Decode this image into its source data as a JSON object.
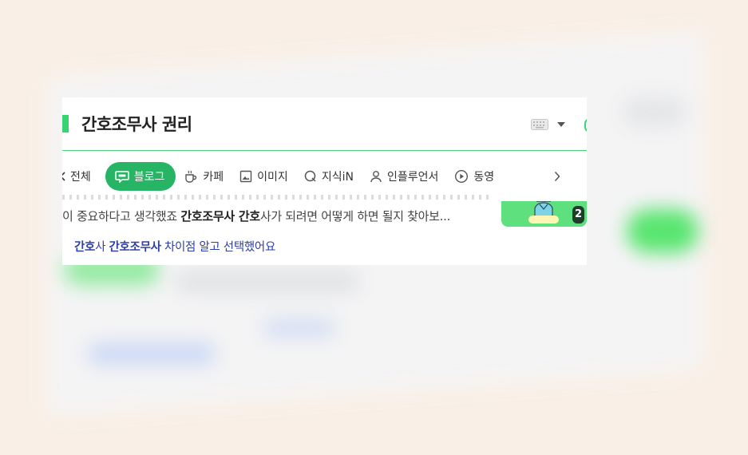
{
  "search": {
    "query": "간호조무사 권리"
  },
  "tabs": [
    {
      "label": "전체",
      "icon": "all-icon"
    },
    {
      "label": "블로그",
      "icon": "blog-icon",
      "active": true
    },
    {
      "label": "카페",
      "icon": "cafe-icon"
    },
    {
      "label": "이미지",
      "icon": "image-icon"
    },
    {
      "label": "지식iN",
      "icon": "kin-icon"
    },
    {
      "label": "인플루언서",
      "icon": "person-icon"
    },
    {
      "label": "동영",
      "icon": "video-icon"
    }
  ],
  "result": {
    "snippet_parts": [
      "이 중요하다고 생각했죠 ",
      "간호조무사 간호",
      "사가 되려면 어떻게 하면 될지 찾아보..."
    ],
    "link_parts": [
      "간호",
      "사 ",
      "간호조무사",
      " 차이점 알고 선택했어요"
    ],
    "thumb_count": "2"
  },
  "colors": {
    "accent": "#27b565",
    "link": "#2e3fa6",
    "background": "#f9efe6"
  }
}
